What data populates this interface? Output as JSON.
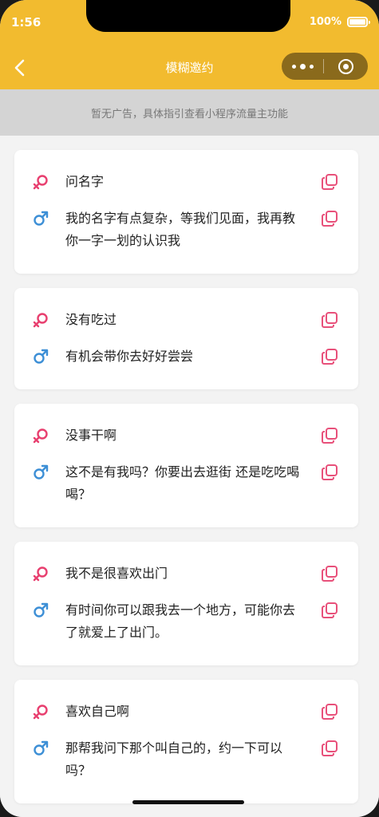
{
  "status": {
    "time": "1:56",
    "battery": "100%"
  },
  "nav": {
    "title": "模糊邀约"
  },
  "ad": {
    "text": "暂无广告，具体指引查看小程序流量主功能"
  },
  "colors": {
    "brand": "#f2bb2f",
    "female": "#e83f6f",
    "male": "#3d8fd6",
    "copy": "#e8507a"
  },
  "cards": [
    {
      "her": "问名字",
      "him": "我的名字有点复杂，等我们见面，我再教你一字一划的认识我"
    },
    {
      "her": "没有吃过",
      "him": "有机会带你去好好尝尝"
    },
    {
      "her": "没事干啊",
      "him": "这不是有我吗？你要出去逛街 还是吃吃喝喝？"
    },
    {
      "her": "我不是很喜欢出门",
      "him": "有时间你可以跟我去一个地方，可能你去了就爱上了出门。"
    },
    {
      "her": "喜欢自己啊",
      "him": "那帮我问下那个叫自己的，约一下可以吗？"
    }
  ]
}
